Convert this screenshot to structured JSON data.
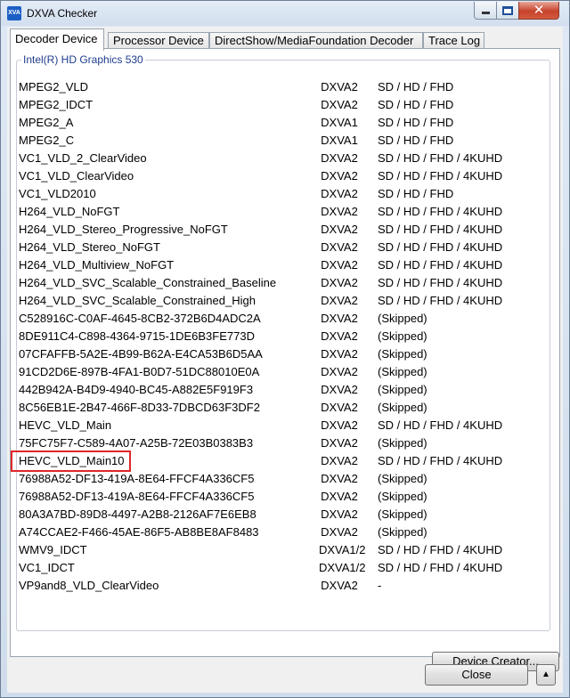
{
  "window": {
    "title": "DXVA Checker",
    "app_icon_text": "XVA"
  },
  "tabs": [
    {
      "label": "Decoder Device",
      "active": true
    },
    {
      "label": "Processor Device",
      "active": false
    },
    {
      "label": "DirectShow/MediaFoundation Decoder",
      "active": false
    },
    {
      "label": "Trace Log",
      "active": false
    }
  ],
  "group": {
    "label": "Intel(R) HD Graphics 530"
  },
  "decoders": [
    {
      "name": "MPEG2_VLD",
      "api": "DXVA2",
      "resolutions": "SD / HD / FHD"
    },
    {
      "name": "MPEG2_IDCT",
      "api": "DXVA2",
      "resolutions": "SD / HD / FHD"
    },
    {
      "name": "MPEG2_A",
      "api": "DXVA1",
      "resolutions": "SD / HD / FHD"
    },
    {
      "name": "MPEG2_C",
      "api": "DXVA1",
      "resolutions": "SD / HD / FHD"
    },
    {
      "name": "VC1_VLD_2_ClearVideo",
      "api": "DXVA2",
      "resolutions": "SD / HD / FHD / 4KUHD"
    },
    {
      "name": "VC1_VLD_ClearVideo",
      "api": "DXVA2",
      "resolutions": "SD / HD / FHD / 4KUHD"
    },
    {
      "name": "VC1_VLD2010",
      "api": "DXVA2",
      "resolutions": "SD / HD / FHD"
    },
    {
      "name": "H264_VLD_NoFGT",
      "api": "DXVA2",
      "resolutions": "SD / HD / FHD / 4KUHD"
    },
    {
      "name": "H264_VLD_Stereo_Progressive_NoFGT",
      "api": "DXVA2",
      "resolutions": "SD / HD / FHD / 4KUHD"
    },
    {
      "name": "H264_VLD_Stereo_NoFGT",
      "api": "DXVA2",
      "resolutions": "SD / HD / FHD / 4KUHD"
    },
    {
      "name": "H264_VLD_Multiview_NoFGT",
      "api": "DXVA2",
      "resolutions": "SD / HD / FHD / 4KUHD"
    },
    {
      "name": "H264_VLD_SVC_Scalable_Constrained_Baseline",
      "api": "DXVA2",
      "resolutions": "SD / HD / FHD / 4KUHD"
    },
    {
      "name": "H264_VLD_SVC_Scalable_Constrained_High",
      "api": "DXVA2",
      "resolutions": "SD / HD / FHD / 4KUHD"
    },
    {
      "name": "C528916C-C0AF-4645-8CB2-372B6D4ADC2A",
      "api": "DXVA2",
      "resolutions": "(Skipped)"
    },
    {
      "name": "8DE911C4-C898-4364-9715-1DE6B3FE773D",
      "api": "DXVA2",
      "resolutions": "(Skipped)"
    },
    {
      "name": "07CFAFFB-5A2E-4B99-B62A-E4CA53B6D5AA",
      "api": "DXVA2",
      "resolutions": "(Skipped)"
    },
    {
      "name": "91CD2D6E-897B-4FA1-B0D7-51DC88010E0A",
      "api": "DXVA2",
      "resolutions": "(Skipped)"
    },
    {
      "name": "442B942A-B4D9-4940-BC45-A882E5F919F3",
      "api": "DXVA2",
      "resolutions": "(Skipped)"
    },
    {
      "name": "8C56EB1E-2B47-466F-8D33-7DBCD63F3DF2",
      "api": "DXVA2",
      "resolutions": "(Skipped)"
    },
    {
      "name": "HEVC_VLD_Main",
      "api": "DXVA2",
      "resolutions": "SD / HD / FHD / 4KUHD"
    },
    {
      "name": "75FC75F7-C589-4A07-A25B-72E03B0383B3",
      "api": "DXVA2",
      "resolutions": "(Skipped)"
    },
    {
      "name": "HEVC_VLD_Main10",
      "api": "DXVA2",
      "resolutions": "SD / HD / FHD / 4KUHD",
      "highlighted": true
    },
    {
      "name": "76988A52-DF13-419A-8E64-FFCF4A336CF5",
      "api": "DXVA2",
      "resolutions": "(Skipped)"
    },
    {
      "name": "76988A52-DF13-419A-8E64-FFCF4A336CF5",
      "api": "DXVA2",
      "resolutions": "(Skipped)"
    },
    {
      "name": "80A3A7BD-89D8-4497-A2B8-2126AF7E6EB8",
      "api": "DXVA2",
      "resolutions": "(Skipped)"
    },
    {
      "name": "A74CCAE2-F466-45AE-86F5-AB8BE8AF8483",
      "api": "DXVA2",
      "resolutions": "(Skipped)"
    },
    {
      "name": "WMV9_IDCT",
      "api": "DXVA1/2",
      "resolutions": "SD / HD / FHD / 4KUHD"
    },
    {
      "name": "VC1_IDCT",
      "api": "DXVA1/2",
      "resolutions": "SD / HD / FHD / 4KUHD"
    },
    {
      "name": "VP9and8_VLD_ClearVideo",
      "api": "DXVA2",
      "resolutions": "-"
    }
  ],
  "buttons": {
    "device_creator": "Device Creator...",
    "close": "Close",
    "up": "▲"
  },
  "colors": {
    "highlight_border": "#e0262b",
    "group_label": "#1e3c8c",
    "close_button_red": "#c7432c"
  }
}
